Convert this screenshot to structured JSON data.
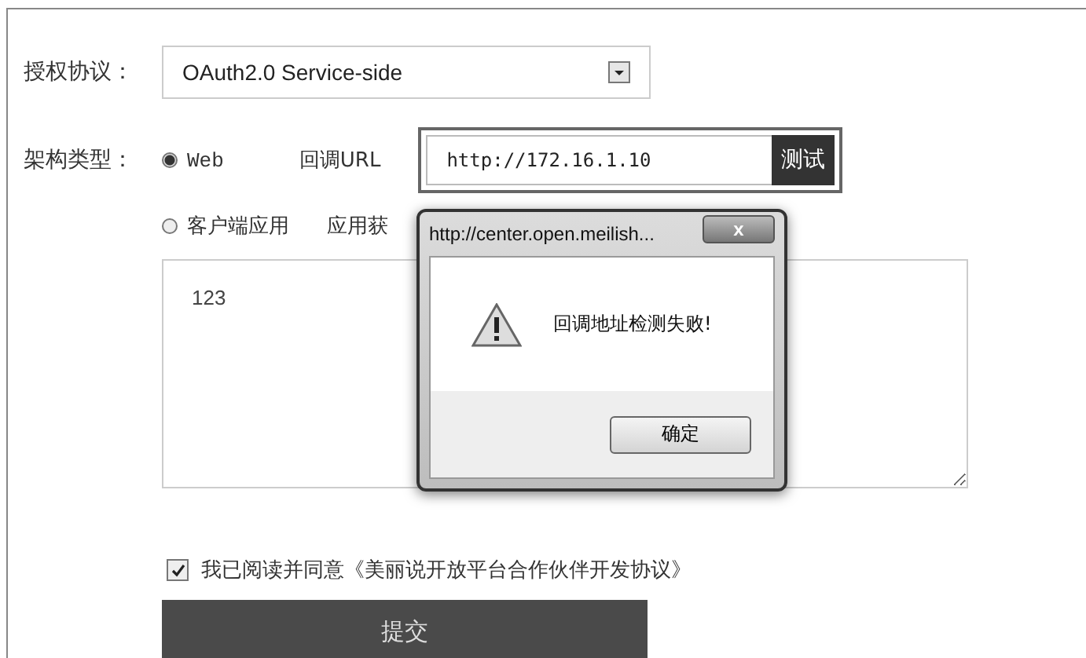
{
  "protocol": {
    "label": "授权协议：",
    "value": "OAuth2.0 Service-side"
  },
  "architecture": {
    "label": "架构类型：",
    "options": [
      {
        "label": "Web",
        "selected": true
      },
      {
        "label": "客户端应用",
        "selected": false
      }
    ]
  },
  "callback": {
    "label": "回调URL",
    "value": "http://172.16.1.10",
    "button": "测试"
  },
  "app_label": "应用获",
  "description": {
    "value": "123"
  },
  "dialog": {
    "title": "http://center.open.meilish...",
    "close": "x",
    "message": "回调地址检测失败!",
    "button": "确定"
  },
  "agreement": {
    "checked": true,
    "text": "我已阅读并同意《美丽说开放平台合作伙伴开发协议》"
  },
  "submit": "提交"
}
